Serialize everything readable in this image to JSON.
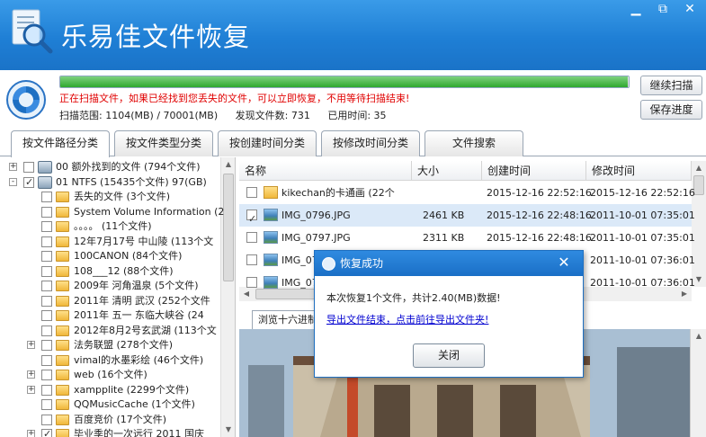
{
  "app": {
    "title": "乐易佳文件恢复",
    "controls": {
      "restore": "⧉",
      "minimize": "▁",
      "close": "✕"
    }
  },
  "scan": {
    "progress": 0.998,
    "message": "正在扫描文件，如果已经找到您丢失的文件，可以立即恢复，不用等待扫描结束!",
    "range": "扫描范围: 1104(MB) / 70001(MB)",
    "found": "发现文件数:  731",
    "elapsed": "已用时间: 35",
    "continue_label": "继续扫描",
    "save_label": "保存进度"
  },
  "tabs": [
    "按文件路径分类",
    "按文件类型分类",
    "按创建时间分类",
    "按修改时间分类",
    "文件搜索"
  ],
  "tree": [
    {
      "exp": "+",
      "check": false,
      "icon": "drive",
      "label": "00  额外找到的文件    (794个文件)"
    },
    {
      "exp": "-",
      "check": true,
      "icon": "drive",
      "label": "01  NTFS    (15435个文件) 97(GB)"
    },
    {
      "exp": "",
      "check": false,
      "icon": "folder",
      "label": "丢失的文件    (3个文件)"
    },
    {
      "exp": "",
      "check": false,
      "icon": "folder",
      "label": "System Volume Information    (2"
    },
    {
      "exp": "",
      "check": false,
      "icon": "folder",
      "label": "。。。。       (11个文件)"
    },
    {
      "exp": "",
      "check": false,
      "icon": "folder",
      "label": "12年7月17号  中山陵    (113个文"
    },
    {
      "exp": "",
      "check": false,
      "icon": "folder",
      "label": "100CANON    (84个文件)"
    },
    {
      "exp": "",
      "check": false,
      "icon": "folder",
      "label": "108___12    (88个文件)"
    },
    {
      "exp": "",
      "check": false,
      "icon": "folder",
      "label": "2009年  河角温泉    (5个文件)"
    },
    {
      "exp": "",
      "check": false,
      "icon": "folder",
      "label": "2011年  清明  武汉    (252个文件"
    },
    {
      "exp": "",
      "check": false,
      "icon": "folder",
      "label": "2011年  五一  东临大峡谷    (24"
    },
    {
      "exp": "",
      "check": false,
      "icon": "folder",
      "label": "2012年8月2号玄武湖    (113个文"
    },
    {
      "exp": "+",
      "check": false,
      "icon": "folder",
      "label": "法务联盟    (278个文件)"
    },
    {
      "exp": "",
      "check": false,
      "icon": "folder",
      "label": "vimal的水墨彩绘    (46个文件)"
    },
    {
      "exp": "+",
      "check": false,
      "icon": "folder",
      "label": "web    (16个文件)"
    },
    {
      "exp": "+",
      "check": false,
      "icon": "folder",
      "label": "xampplite    (2299个文件)"
    },
    {
      "exp": "",
      "check": false,
      "icon": "folder",
      "label": "QQMusicCache    (1个文件)"
    },
    {
      "exp": "",
      "check": false,
      "icon": "folder",
      "label": "百度竞价    (17个文件)"
    },
    {
      "exp": "+",
      "check": true,
      "icon": "folder",
      "label": "毕业季的一次远行 2011 国庆"
    }
  ],
  "list": {
    "columns": [
      "名称",
      "大小",
      "创建时间",
      "修改时间"
    ],
    "rows": [
      {
        "icon": "folder",
        "check": false,
        "selected": false,
        "name": "kikechan的卡通画    (22个",
        "size": "",
        "created": "2015-12-16  22:52:16",
        "modified": "2015-12-16  22:52:16"
      },
      {
        "icon": "image",
        "check": true,
        "selected": true,
        "name": "IMG_0796.JPG",
        "size": "2461 KB",
        "created": "2015-12-16  22:48:16",
        "modified": "2011-10-01  07:35:01"
      },
      {
        "icon": "image",
        "check": false,
        "selected": false,
        "name": "IMG_0797.JPG",
        "size": "2311 KB",
        "created": "2015-12-16  22:48:16",
        "modified": "2011-10-01  07:35:01"
      },
      {
        "icon": "image",
        "check": false,
        "selected": false,
        "name": "IMG_07",
        "size": "",
        "created": "",
        "modified": "2011-10-01  07:36:01"
      },
      {
        "icon": "image",
        "check": false,
        "selected": false,
        "name": "IMG_07",
        "size": "",
        "created": "",
        "modified": "2011-10-01  07:36:01"
      }
    ]
  },
  "preview": {
    "tab_label": "浏览十六进制"
  },
  "dialog": {
    "title": "恢复成功",
    "close": "✕",
    "message": "本次恢复1个文件，共计2.40(MB)数据!",
    "link": "导出文件结束，点击前往导出文件夹!",
    "button": "关闭"
  }
}
